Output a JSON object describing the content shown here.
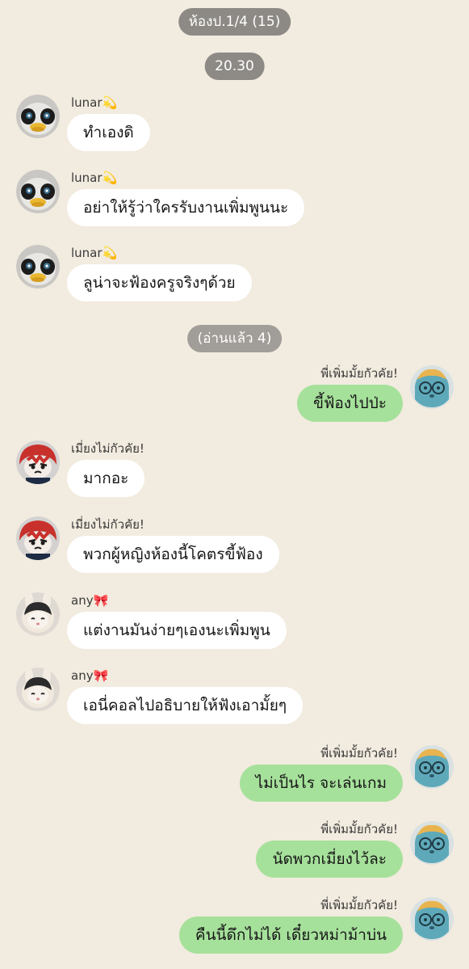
{
  "chat": {
    "room_label": "ห้องป.1/4 (15)",
    "time_label": "20.30",
    "read_label": "(อ่านแล้ว 4)",
    "messages": [
      {
        "sender": "lunar💫",
        "text": "ทำเองดิ",
        "side": "left",
        "avatar": "penguin-avatar"
      },
      {
        "sender": "lunar💫",
        "text": "อย่าให้รู้ว่าใครรับงานเพิ่มพูนนะ",
        "side": "left",
        "avatar": "penguin-avatar"
      },
      {
        "sender": "lunar💫",
        "text": "ลูน่าจะฟ้องครูจริงๆด้วย",
        "side": "left",
        "avatar": "penguin-avatar"
      },
      {
        "sender": "พี่เพิ่มมั้ยกัวคัย!",
        "text": "ขี้ฟ้องไปป่ะ",
        "side": "right",
        "avatar": "blue-plush-avatar"
      },
      {
        "sender": "เมี่ยงไม่กัวคัย!",
        "text": "มากอะ",
        "side": "left",
        "avatar": "red-plush-avatar"
      },
      {
        "sender": "เมี่ยงไม่กัวคัย!",
        "text": "พวกผู้หญิงห้องนี้โคตรขี้ฟ้อง",
        "side": "left",
        "avatar": "red-plush-avatar"
      },
      {
        "sender": "any🎀",
        "text": "แต่งานมันง่ายๆเองนะเพิ่มพูน",
        "side": "left",
        "avatar": "bunny-plush-avatar"
      },
      {
        "sender": "any🎀",
        "text": "เอนี่คอลไปอธิบายให้ฟังเอามั้ยๆ",
        "side": "left",
        "avatar": "bunny-plush-avatar"
      },
      {
        "sender": "พี่เพิ่มมั้ยกัวคัย!",
        "text": "ไม่เป็นไร จะเล่นเกม",
        "side": "right",
        "avatar": "blue-plush-avatar"
      },
      {
        "sender": "พี่เพิ่มมั้ยกัวคัย!",
        "text": "นัดพวกเมี่ยงไว้ละ",
        "side": "right",
        "avatar": "blue-plush-avatar"
      },
      {
        "sender": "พี่เพิ่มมั้ยกัวคัย!",
        "text": "คืนนี้ดึกไม่ได้ เดี๋ยวหม่าม้าบ่น",
        "side": "right",
        "avatar": "blue-plush-avatar"
      }
    ]
  },
  "colors": {
    "background": "#f2ebdf",
    "incoming_bubble": "#ffffff",
    "outgoing_bubble": "#a6e19b",
    "pill": "#8d8a86"
  }
}
